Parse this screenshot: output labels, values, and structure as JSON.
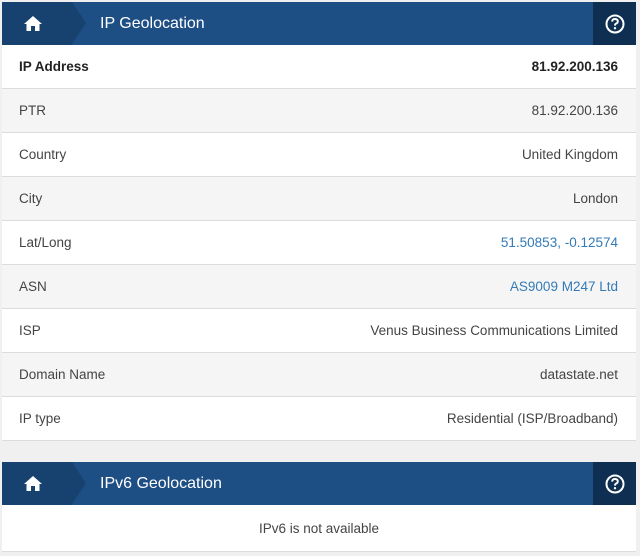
{
  "panel1": {
    "title": "IP Geolocation",
    "rows": [
      {
        "label": "IP Address",
        "value": "81.92.200.136"
      },
      {
        "label": "PTR",
        "value": "81.92.200.136"
      },
      {
        "label": "Country",
        "value": "United Kingdom"
      },
      {
        "label": "City",
        "value": "London"
      },
      {
        "label": "Lat/Long",
        "value": "51.50853, -0.12574"
      },
      {
        "label": "ASN",
        "value": "AS9009 M247 Ltd"
      },
      {
        "label": "ISP",
        "value": "Venus Business Communications Limited"
      },
      {
        "label": "Domain Name",
        "value": "datastate.net"
      },
      {
        "label": "IP type",
        "value": "Residential (ISP/Broadband)"
      }
    ]
  },
  "panel2": {
    "title": "IPv6 Geolocation",
    "message": "IPv6 is not available"
  },
  "icons": {
    "home": "home-icon",
    "help": "help-icon"
  },
  "colors": {
    "header": "#1d4e84",
    "home_tab": "#174270",
    "help_bg": "#0f2f52",
    "link": "#337ab7"
  }
}
